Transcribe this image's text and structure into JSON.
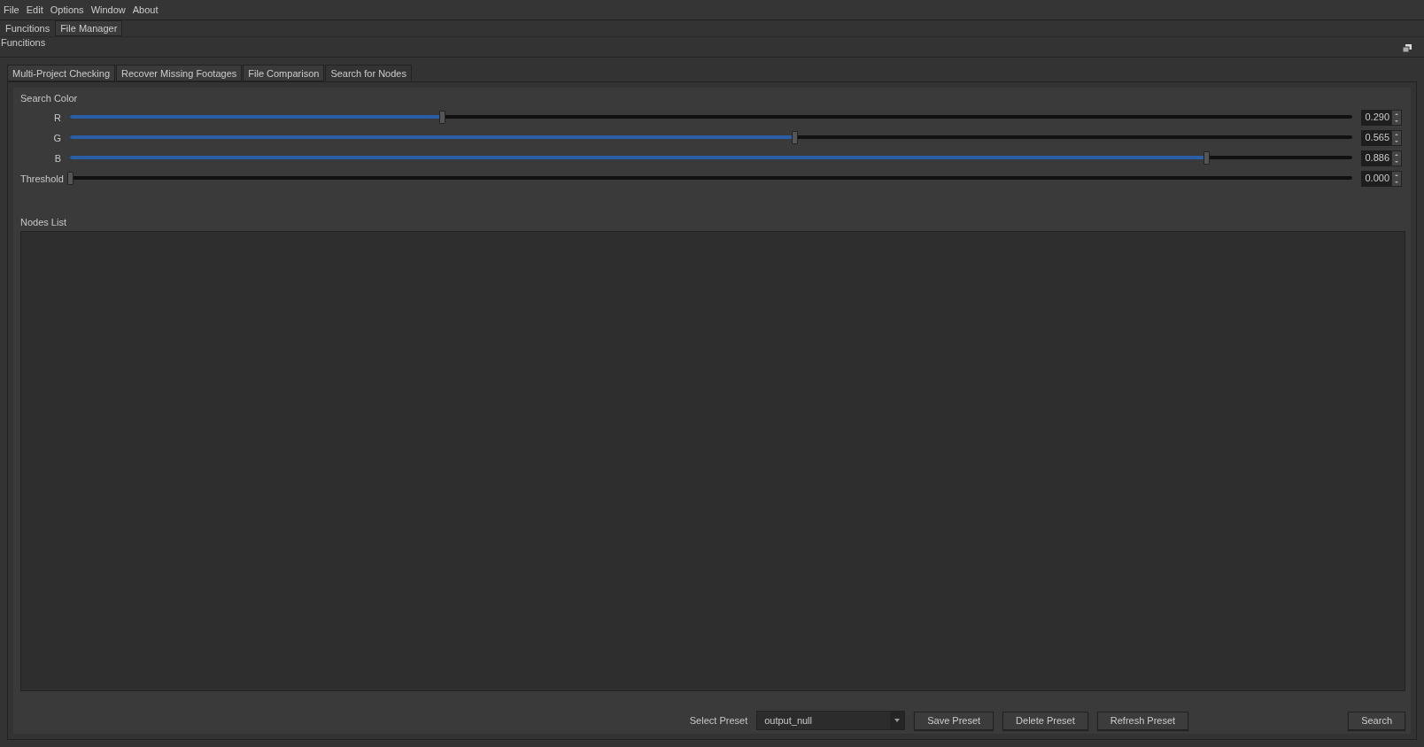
{
  "menu": [
    "File",
    "Edit",
    "Options",
    "Window",
    "About"
  ],
  "top_tabs": [
    {
      "label": "Funcitions",
      "selected": true
    },
    {
      "label": "File Manager",
      "selected": false
    }
  ],
  "section_title": "Funcitions",
  "tabs": [
    {
      "label": "Multi-Project Checking",
      "selected": false
    },
    {
      "label": "Recover Missing Footages",
      "selected": false
    },
    {
      "label": "File Comparison",
      "selected": false
    },
    {
      "label": "Search for Nodes",
      "selected": true
    }
  ],
  "search_color": {
    "title": "Search Color",
    "sliders": [
      {
        "label": "R",
        "level": 0.29,
        "reading": "0.290",
        "kind": "color"
      },
      {
        "label": "G",
        "level": 0.565,
        "reading": "0.565",
        "kind": "color"
      },
      {
        "label": "B",
        "level": 0.886,
        "reading": "0.886",
        "kind": "color"
      },
      {
        "label": "Threshold",
        "level": 0,
        "reading": "0.000",
        "kind": "plain"
      }
    ]
  },
  "nodes_list": {
    "title": "Nodes List"
  },
  "footer": {
    "preset_label": "Select Preset",
    "preset_value": "output_null",
    "buttons": [
      "Save Preset",
      "Delete Preset",
      "Refresh Preset"
    ],
    "search_button": "Search"
  }
}
